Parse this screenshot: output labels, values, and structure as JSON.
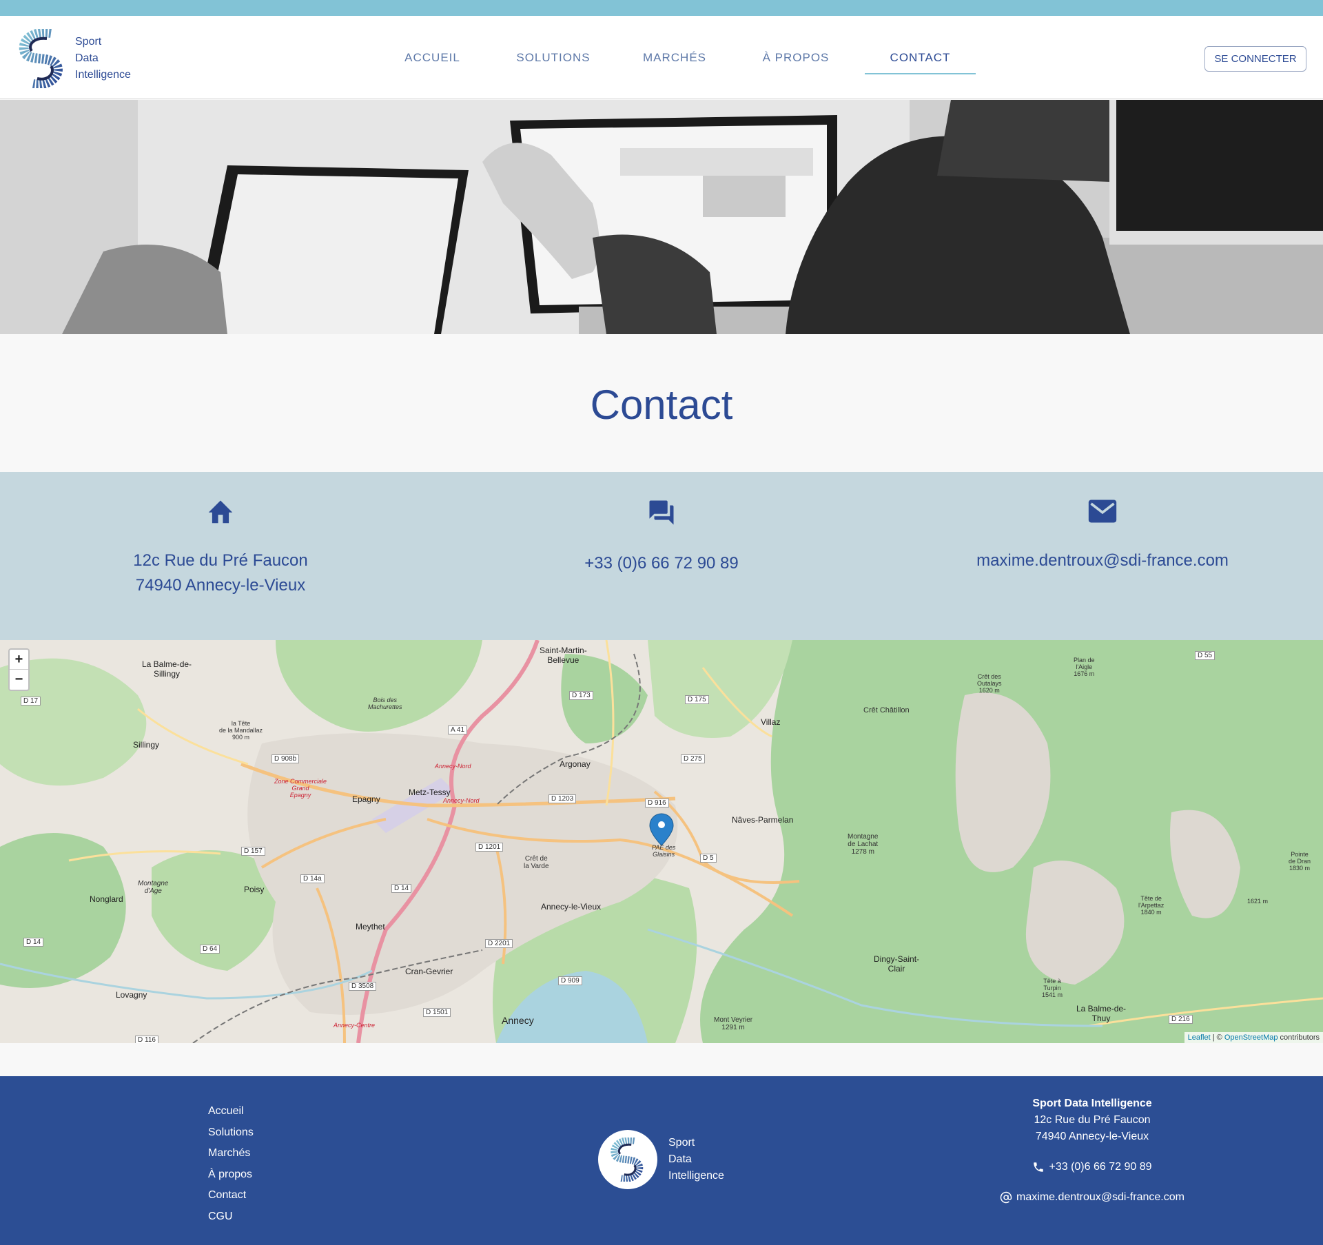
{
  "brand": {
    "line1": "Sport",
    "line2": "Data",
    "line3": "Intelligence",
    "color_primary": "#2c4a94",
    "color_accent": "#82c3d6"
  },
  "nav": {
    "items": [
      {
        "label": "ACCUEIL"
      },
      {
        "label": "SOLUTIONS"
      },
      {
        "label": "MARCHÉS"
      },
      {
        "label": "À PROPOS"
      },
      {
        "label": "CONTACT",
        "active": true
      }
    ],
    "login_label": "SE CONNECTER"
  },
  "hero": {
    "image": "black-and-white photo of people working on laptops"
  },
  "page": {
    "title": "Contact"
  },
  "contact": {
    "address_line1": "12c Rue du Pré Faucon",
    "address_line2": "74940 Annecy-le-Vieux",
    "phone": "+33 (0)6 66 72 90 89",
    "email": "maxime.dentroux@sdi-france.com",
    "icons": [
      "home-icon",
      "chat-icon",
      "mail-icon"
    ]
  },
  "map": {
    "zoom_in": "+",
    "zoom_out": "−",
    "attribution_leaflet": "Leaflet",
    "attribution_sep": " | © ",
    "attribution_osm": "OpenStreetMap",
    "attribution_suffix": " contributors",
    "marker_label_1": "PAE des",
    "marker_label_2": "Glaisins",
    "labels": {
      "saint_martin": "Saint-Martin-",
      "bellevue": "Bellevue",
      "balme_sillingy": "La Balme-de-",
      "sillingy_top": "Sillingy",
      "sillingy": "Sillingy",
      "epagny": "Epagny",
      "metz_tessy": "Metz-Tessy",
      "argonay": "Argonay",
      "villaz": "Villaz",
      "naves": "Nâves-Parmelan",
      "annecy_le_vieux": "Annecy-le-Vieux",
      "meythet": "Meythet",
      "poisy": "Poisy",
      "nonglard": "Nonglard",
      "cran_gevrier": "Cran-Gevrier",
      "annecy": "Annecy",
      "lovagny": "Lovagny",
      "dingy": "Dingy-Saint-",
      "dingy2": "Clair",
      "balme_thuy": "La Balme-de-",
      "thuy": "Thuy",
      "cret_chatillon": "Crêt Châtillon",
      "montagne_lachat": "Montagne",
      "montagne_lachat2": "de Lachat",
      "montagne_lachat3": "1278 m",
      "cret_varde": "Crêt de",
      "cret_varde2": "la Varde",
      "montagne_age": "Montagne",
      "montagne_age2": "d'Age",
      "mont_veyrier": "Mont Veyrier",
      "mont_veyrier2": "1291 m",
      "zone_commerciale": "Zone Commerciale",
      "zone_commerciale2": "Grand",
      "zone_commerciale3": "Epagny",
      "tete_mandallaz": "la Tête",
      "tete_mandallaz2": "de la Mandallaz",
      "tete_mandallaz3": "900 m",
      "bois": "Bois des",
      "bois2": "Machurettes",
      "plan_aigle": "Plan de",
      "plan_aigle2": "l'Aigle",
      "plan_aigle3": "1676 m",
      "cret_outalays": "Crêt des",
      "cret_outalays2": "Outalays",
      "cret_outalays3": "1620 m",
      "tete_arpettaz": "Tête de",
      "tete_arpettaz2": "l'Arpettaz",
      "tete_arpettaz3": "1840 m",
      "tete_turpin": "Tête à",
      "tete_turpin2": "Turpin",
      "tete_turpin3": "1541 m",
      "pointe_dran": "Pointe",
      "pointe_dran2": "de Dran",
      "pointe_dran3": "1830 m",
      "m1621": "1621 m",
      "annecy_nord": "Annecy-Nord",
      "annecy_nord2": "Annecy-Nord",
      "annecy_centre": "Annecy-Centre"
    },
    "roads": {
      "a41": "A 41",
      "d173": "D 173",
      "d175": "D 175",
      "d55": "D 55",
      "d17": "D 17",
      "d908b": "D 908b",
      "d275": "D 275",
      "d1203": "D 1203",
      "d916": "D 916",
      "d157": "D 157",
      "d1201": "D 1201",
      "d5": "D 5",
      "d14a": "D 14a",
      "d14b": "D 14",
      "d14": "D 14",
      "d64": "D 64",
      "d2201": "D 2201",
      "d909": "D 909",
      "d3508": "D 3508",
      "d1501": "D 1501",
      "d216": "D 216",
      "d116": "D 116"
    }
  },
  "footer": {
    "links": [
      "Accueil",
      "Solutions",
      "Marchés",
      "À propos",
      "Contact",
      "CGU"
    ],
    "company": "Sport Data Intelligence",
    "address_line1": "12c Rue du Pré Faucon",
    "address_line2": "74940 Annecy-le-Vieux",
    "phone": "+33 (0)6 66 72 90 89",
    "email": "maxime.dentroux@sdi-france.com"
  }
}
